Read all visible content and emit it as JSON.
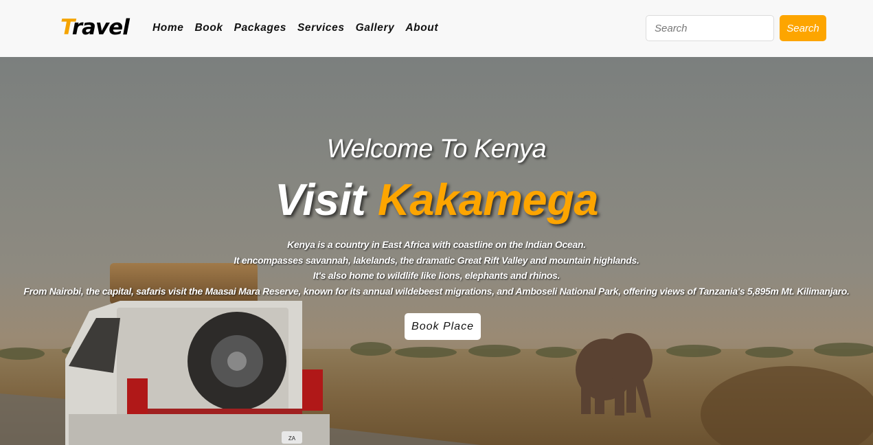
{
  "navbar": {
    "brand_first": "T",
    "brand_rest": "ravel",
    "links": [
      "Home",
      "Book",
      "Packages",
      "Services",
      "Gallery",
      "About"
    ],
    "search_placeholder": "Search",
    "search_button": "Search"
  },
  "hero": {
    "welcome": "Welcome To Kenya",
    "headline_white": "Visit",
    "headline_accent": "Kakamega",
    "description": [
      "Kenya is a country in East Africa with coastline on the Indian Ocean.",
      "It encompasses savannah, lakelands, the dramatic Great Rift Valley and mountain highlands.",
      "It's also home to wildlife like lions, elephants and rhinos.",
      "From Nairobi, the capital, safaris visit the Maasai Mara Reserve, known for its annual wildebeest migrations, and Amboseli National Park, offering views of Tanzania's 5,895m Mt. Kilimanjaro."
    ],
    "cta_button": "Book Place",
    "plate_text": "ZA"
  },
  "colors": {
    "accent": "#fda500",
    "navbar_bg": "#f8f8f8"
  }
}
